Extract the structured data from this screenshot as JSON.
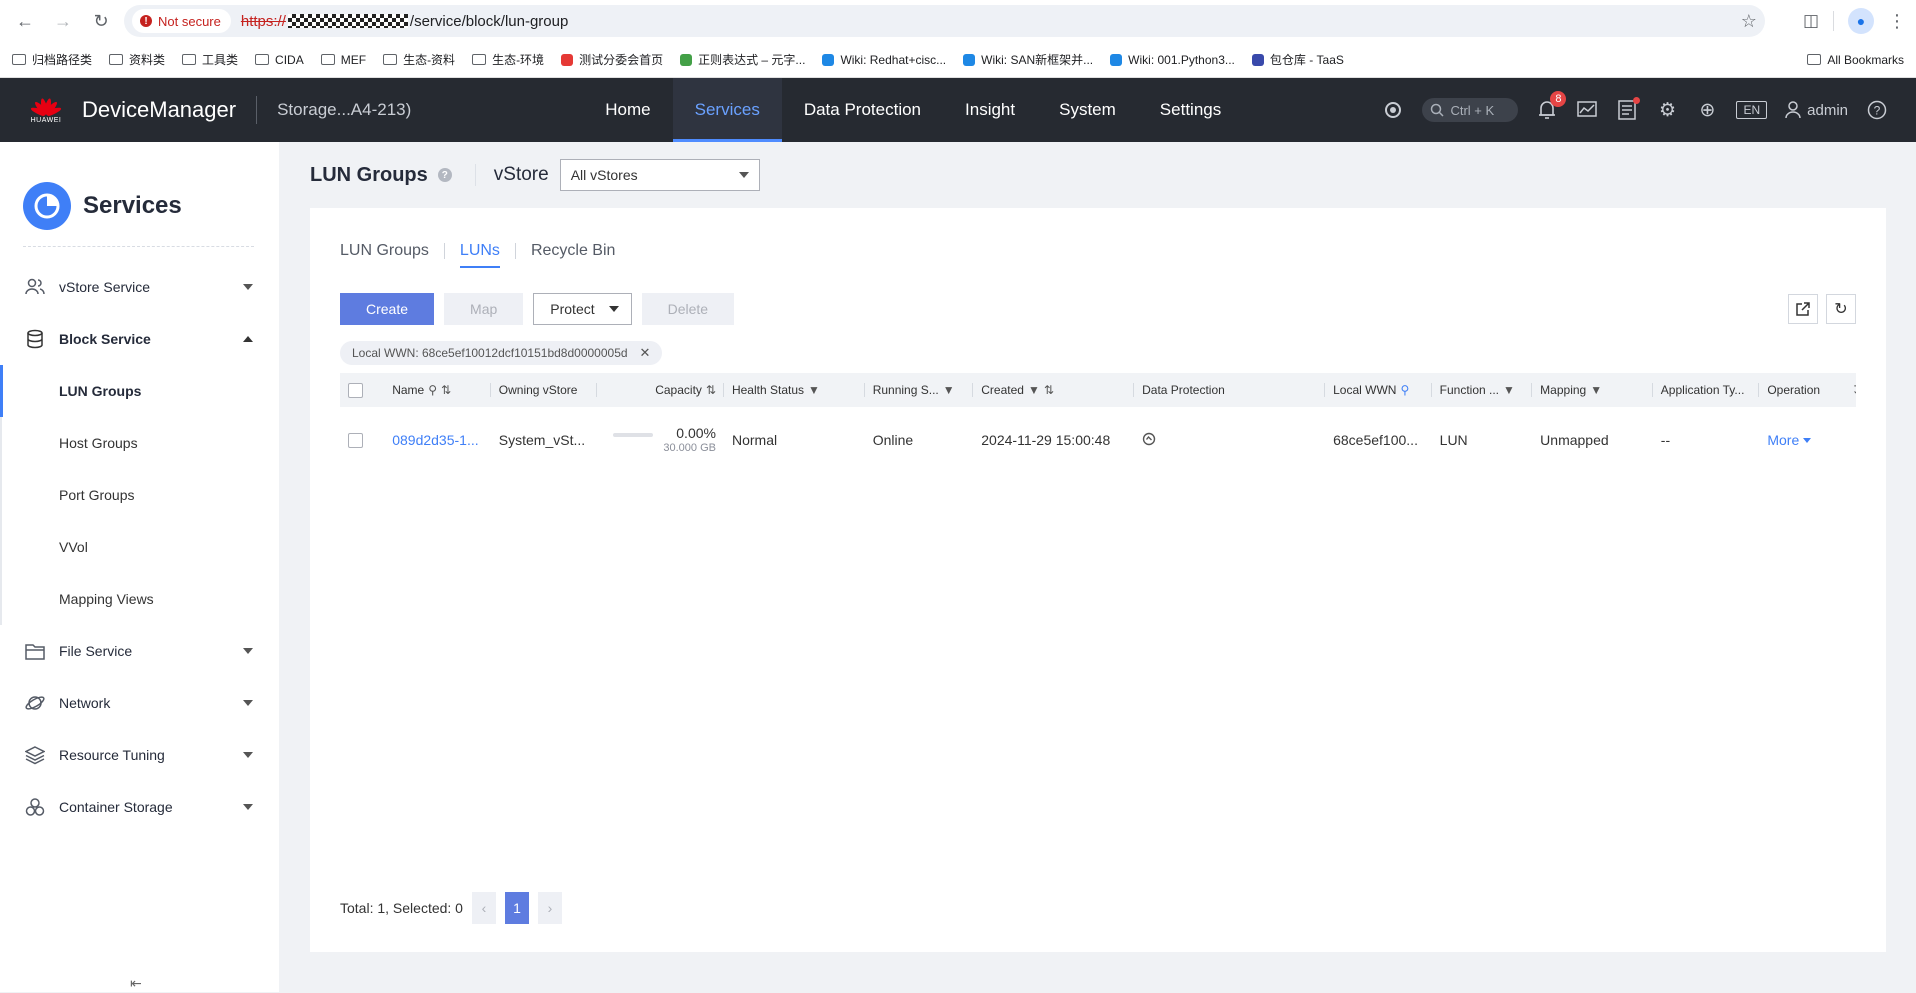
{
  "browser": {
    "security_label": "Not secure",
    "url_scheme": "https://",
    "url_path": "/service/block/lun-group",
    "bookmarks": [
      {
        "label": "归档路径类",
        "icon": "folder-icon"
      },
      {
        "label": "资料类",
        "icon": "folder-icon"
      },
      {
        "label": "工具类",
        "icon": "folder-icon"
      },
      {
        "label": "CIDA",
        "icon": "folder-icon"
      },
      {
        "label": "MEF",
        "icon": "folder-icon"
      },
      {
        "label": "生态-资料",
        "icon": "folder-icon"
      },
      {
        "label": "生态-环境",
        "icon": "folder-icon"
      },
      {
        "label": "测试分委会首页",
        "icon": "favicon",
        "color": "#e53935"
      },
      {
        "label": "正则表达式 – 元字...",
        "icon": "favicon",
        "color": "#43a047"
      },
      {
        "label": "Wiki: Redhat+cisc...",
        "icon": "favicon",
        "color": "#1e88e5"
      },
      {
        "label": "Wiki: SAN新框架并...",
        "icon": "favicon",
        "color": "#1e88e5"
      },
      {
        "label": "Wiki: 001.Python3...",
        "icon": "favicon",
        "color": "#1e88e5"
      },
      {
        "label": "包仓库 - TaaS",
        "icon": "favicon",
        "color": "#3949ab"
      }
    ],
    "all_bookmarks": "All Bookmarks"
  },
  "header": {
    "brand": "HUAWEI",
    "app_name": "DeviceManager",
    "storage_name": "Storage...A4-213)",
    "nav": [
      {
        "label": "Home",
        "active": false
      },
      {
        "label": "Services",
        "active": true
      },
      {
        "label": "Data Protection",
        "active": false
      },
      {
        "label": "Insight",
        "active": false
      },
      {
        "label": "System",
        "active": false
      },
      {
        "label": "Settings",
        "active": false
      }
    ],
    "search_shortcut": "Ctrl + K",
    "alarm_count": "8",
    "language": "EN",
    "user": "admin",
    "accent_color": "#4f8cff"
  },
  "sidebar": {
    "title": "Services",
    "groups": [
      {
        "label": "vStore Service",
        "icon": "users-icon",
        "open": false
      },
      {
        "label": "Block Service",
        "icon": "database-icon",
        "open": true,
        "children": [
          "LUN Groups",
          "Host Groups",
          "Port Groups",
          "VVol",
          "Mapping Views"
        ],
        "active_child": "LUN Groups"
      },
      {
        "label": "File Service",
        "icon": "folder-icon",
        "open": false
      },
      {
        "label": "Network",
        "icon": "planet-icon",
        "open": false
      },
      {
        "label": "Resource Tuning",
        "icon": "layers-icon",
        "open": false
      },
      {
        "label": "Container Storage",
        "icon": "containers-icon",
        "open": false
      }
    ]
  },
  "page": {
    "title": "LUN Groups",
    "vstore_label": "vStore",
    "vstore_value": "All vStores",
    "tabs": [
      {
        "label": "LUN Groups",
        "active": false
      },
      {
        "label": "LUNs",
        "active": true
      },
      {
        "label": "Recycle Bin",
        "active": false
      }
    ],
    "buttons": {
      "create": "Create",
      "map": "Map",
      "protect": "Protect",
      "delete": "Delete"
    },
    "filter_chip": "Local WWN: 68ce5ef10012dcf10151bd8d0000005d",
    "columns": [
      "Name",
      "Owning vStore",
      "Capacity",
      "Health Status",
      "Running S...",
      "Created",
      "Data Protection",
      "Local WWN",
      "Function ...",
      "Mapping",
      "Application Ty...",
      "Operation"
    ],
    "rows": [
      {
        "name": "089d2d35-1...",
        "owning_vstore": "System_vSt...",
        "capacity_pct": "0.00%",
        "capacity_used_fraction": 0.0,
        "capacity_size": "30.000 GB",
        "health": "Normal",
        "running": "Online",
        "created": "2024-11-29 15:00:48",
        "data_protection_icon": "protection-icon",
        "local_wwn": "68ce5ef100...",
        "function": "LUN",
        "mapping": "Unmapped",
        "app_type": "--",
        "operation": "More"
      }
    ],
    "pager": {
      "summary": "Total: 1, Selected: 0",
      "current_page": "1"
    }
  }
}
